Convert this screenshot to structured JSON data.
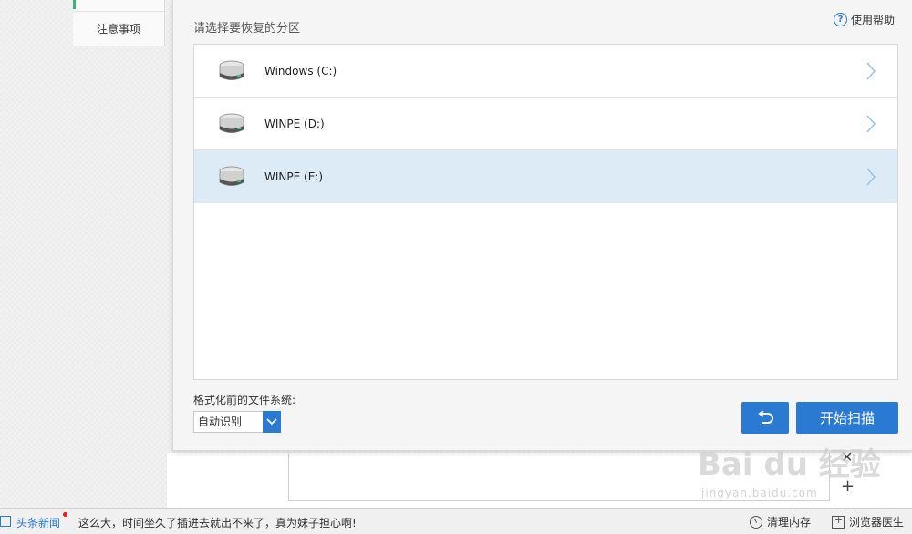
{
  "left_nav": {
    "items": [
      {
        "label": "注意事项"
      }
    ]
  },
  "dialog": {
    "heading": "请选择要恢复的分区",
    "help_label": "使用帮助",
    "partitions": [
      {
        "label": "Windows (C:)",
        "selected": false
      },
      {
        "label": "WINPE (D:)",
        "selected": false
      },
      {
        "label": "WINPE (E:)",
        "selected": true
      }
    ],
    "fs_label": "格式化前的文件系统:",
    "fs_value": "自动识别",
    "start_scan_label": "开始扫描"
  },
  "watermark": {
    "main": "Bai du 经验",
    "sub": "jingyan.baidu.com"
  },
  "status_bar": {
    "news_label": "头条新闻",
    "news_text": "这么大，时间坐久了插进去就出不来了，真为妹子担心啊!",
    "clean_memory_label": "清理内存",
    "browser_doctor_label": "浏览器医生"
  },
  "colors": {
    "accent": "#2a7ad4",
    "selected_row": "#dcebf6",
    "nav_active": "#3cb371"
  },
  "icons": {
    "help": "question-circle-icon",
    "drive": "hard-drive-icon",
    "row_arrow": "chevron-right-icon",
    "dropdown": "chevron-down-icon",
    "back": "undo-arrow-icon",
    "news": "newspaper-icon",
    "clean_memory": "gauge-icon",
    "browser_doctor": "medkit-icon"
  }
}
